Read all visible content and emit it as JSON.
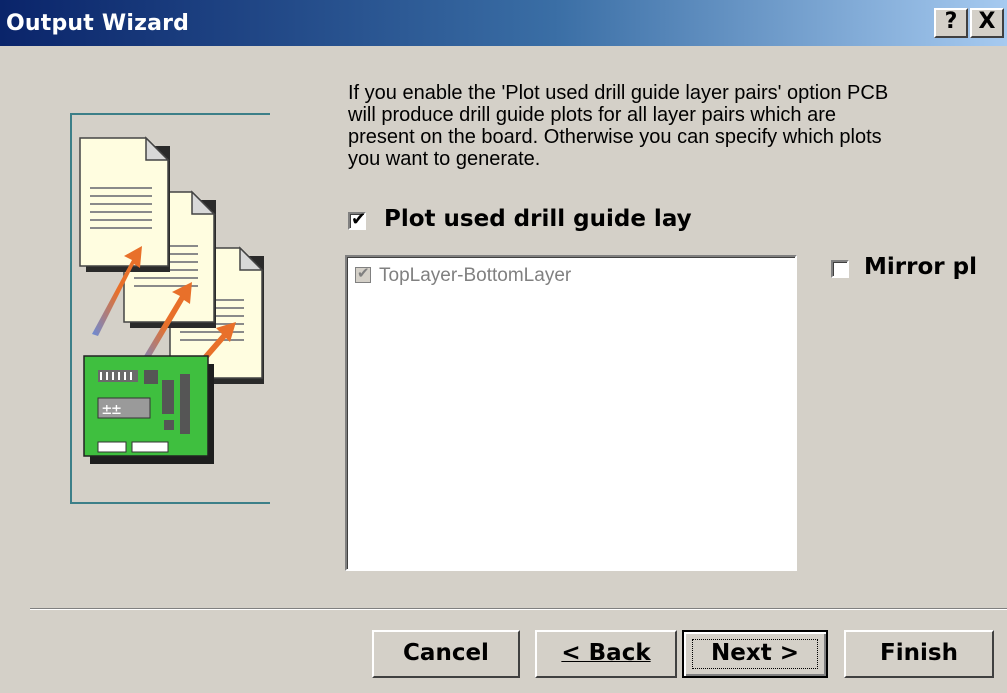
{
  "window": {
    "title": "Output Wizard",
    "help_label": "?",
    "close_label": "X"
  },
  "description": "If you enable the 'Plot used drill guide layer pairs' option PCB\nwill produce drill guide plots for all layer pairs which are\npresent on the board. Otherwise you can specify which plots\nyou want to generate.",
  "plot_used": {
    "label": "Plot used drill guide lay",
    "checked": true
  },
  "mirror": {
    "label": "Mirror pl",
    "checked": false
  },
  "layer_list": {
    "items": [
      {
        "label": "TopLayer-BottomLayer",
        "checked": true,
        "enabled": false
      }
    ]
  },
  "buttons": {
    "cancel": "Cancel",
    "back": "< Back",
    "next": "Next >",
    "finish": "Finish"
  },
  "icons": {
    "wizard_art": "pcb-documents-illustration-icon"
  },
  "colors": {
    "title_start": "#0a246a",
    "title_end": "#a6caf0",
    "board": "#3fbf3f",
    "paper": "#fffde0",
    "arrow": "#e8702a"
  }
}
